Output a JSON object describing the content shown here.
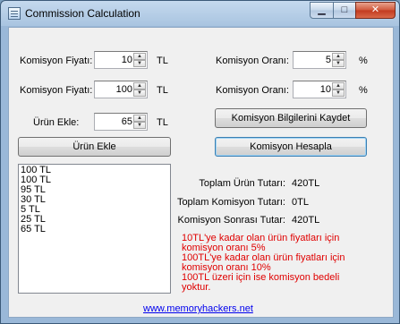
{
  "window": {
    "title": "Commission Calculation"
  },
  "caption_buttons": {
    "minimize": "▁",
    "maximize": "□",
    "close": "✕"
  },
  "form": {
    "row1": {
      "label": "Komisyon Fiyatı:",
      "value": "10",
      "unit": "TL"
    },
    "row2": {
      "label": "Komisyon Fiyatı:",
      "value": "100",
      "unit": "TL"
    },
    "row3": {
      "label": "Ürün Ekle:",
      "value": "65",
      "unit": "TL"
    },
    "rate1": {
      "label": "Komisyon Oranı:",
      "value": "5",
      "unit": "%"
    },
    "rate2": {
      "label": "Komisyon Oranı:",
      "value": "10",
      "unit": "%"
    }
  },
  "buttons": {
    "save_info": "Komisyon Bilgilerini Kaydet",
    "add_product": "Ürün Ekle",
    "calculate": "Komisyon Hesapla"
  },
  "product_list": [
    "100 TL",
    "100 TL",
    "95 TL",
    "30 TL",
    "5 TL",
    "25 TL",
    "65 TL"
  ],
  "summary": {
    "total_products_label": "Toplam Ürün Tutarı:",
    "total_products_value": "420TL",
    "total_commission_label": "Toplam Komisyon Tutarı:",
    "total_commission_value": "0TL",
    "after_commission_label": "Komisyon Sonrası Tutar:",
    "after_commission_value": "420TL"
  },
  "notes": [
    "10TL'ye kadar olan ürün fiyatları için",
    "komisyon oranı 5%",
    "100TL'ye kadar olan ürün fiyatları için",
    "komisyon oranı 10%",
    "100TL üzeri için ise komisyon bedeli",
    "yoktur."
  ],
  "footer_link": "www.memoryhackers.net",
  "colors": {
    "note_text": "#e00000",
    "link": "#0000ee",
    "title_bar": "#a9c4e0"
  }
}
